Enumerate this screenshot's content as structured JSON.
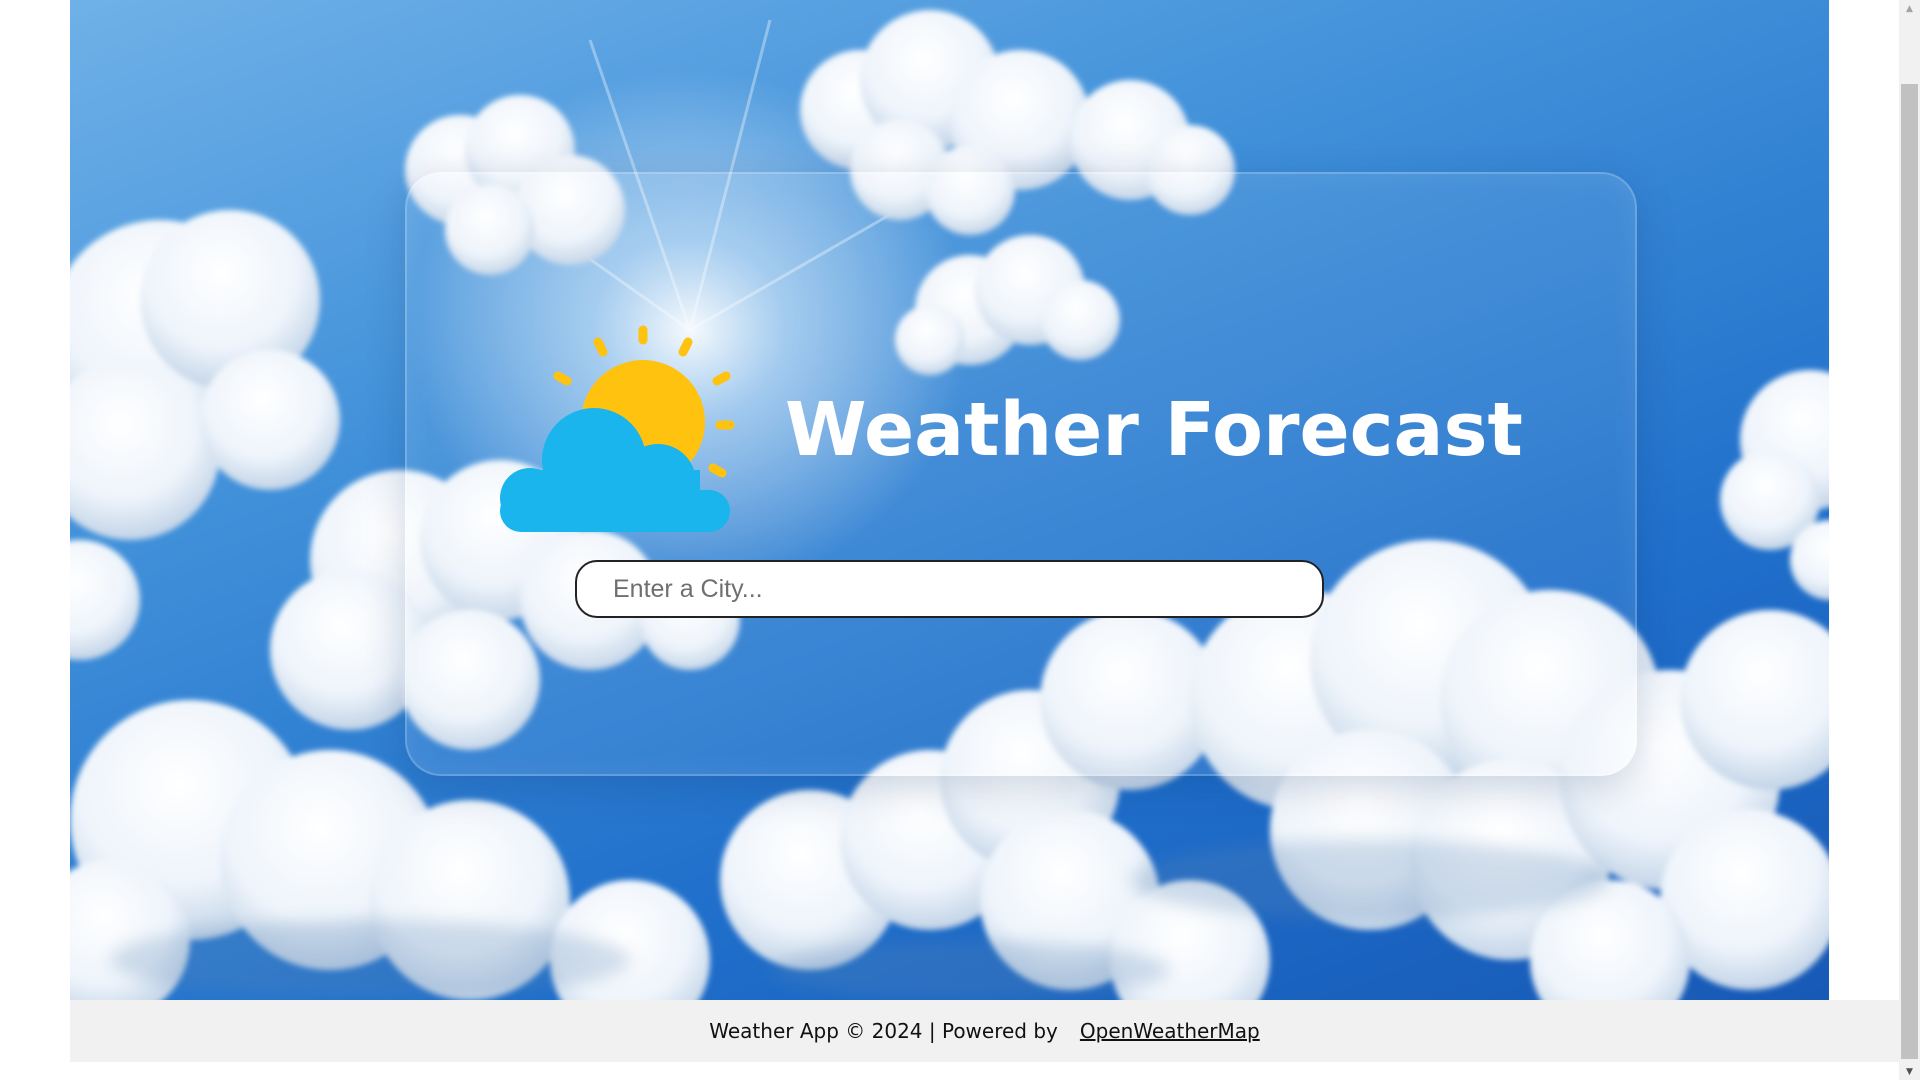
{
  "hero": {
    "title": "Weather Forecast",
    "logo_icon": "sun-behind-cloud-icon",
    "background": "sky-with-clouds"
  },
  "search": {
    "placeholder": "Enter a City...",
    "value": ""
  },
  "footer": {
    "text": "Weather App © 2024 | Powered by",
    "link_label": "OpenWeatherMap"
  },
  "colors": {
    "sky": "#2f80d3",
    "sun": "#FFC20E",
    "cloud_icon": "#19B5EC",
    "title": "#FFFFFF",
    "footer_bg": "#F1F1F1"
  }
}
